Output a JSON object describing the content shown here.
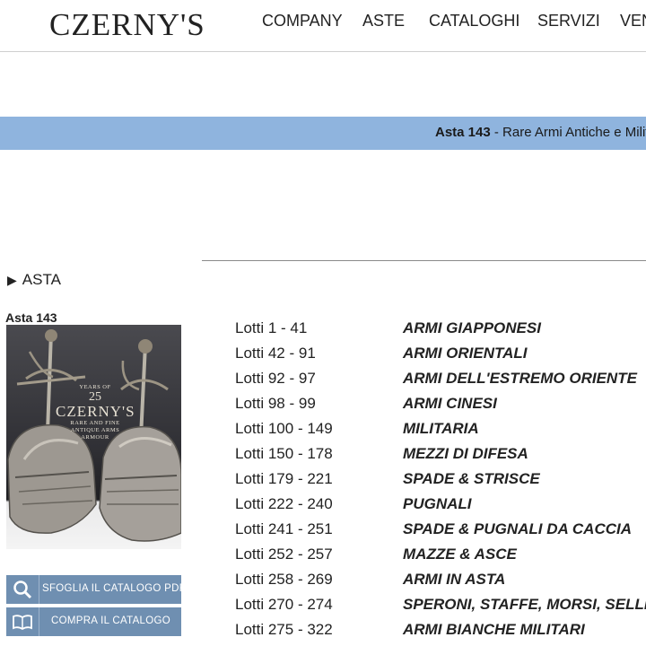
{
  "header": {
    "logo": "CZERNY'S",
    "nav": [
      "COMPANY",
      "ASTE",
      "CATALOGHI",
      "SERVIZI",
      "VEN"
    ]
  },
  "band": {
    "auction_label": "Asta 143",
    "auction_title": " - Rare Armi Antiche e Milita"
  },
  "sidebar": {
    "section_label": "ASTA",
    "auction_number": "Asta 143",
    "cover": {
      "years": "25",
      "years_label": "YEARS OF",
      "brand": "CZERNY'S",
      "line1": "RARE AND FINE",
      "line2": "ANTIQUE ARMS",
      "line3": "ARMOUR"
    },
    "buttons": {
      "browse_pdf": "SFOGLIA IL CATALOGO PDF",
      "buy_catalog": "COMPRA IL CATALOGO"
    }
  },
  "lots": [
    {
      "range": "Lotti 1 - 41",
      "category": "ARMI GIAPPONESI"
    },
    {
      "range": "Lotti 42 - 91",
      "category": "ARMI ORIENTALI"
    },
    {
      "range": "Lotti 92 - 97",
      "category": "ARMI DELL'ESTREMO ORIENTE"
    },
    {
      "range": "Lotti 98 - 99",
      "category": "ARMI CINESI"
    },
    {
      "range": "Lotti 100 - 149",
      "category": "MILITARIA"
    },
    {
      "range": "Lotti 150 - 178",
      "category": "MEZZI DI DIFESA"
    },
    {
      "range": "Lotti 179 - 221",
      "category": "SPADE & STRISCE"
    },
    {
      "range": "Lotti 222 - 240",
      "category": "PUGNALI"
    },
    {
      "range": "Lotti 241 - 251",
      "category": "SPADE & PUGNALI DA CACCIA"
    },
    {
      "range": "Lotti 252 - 257",
      "category": "MAZZE & ASCE"
    },
    {
      "range": "Lotti 258 - 269",
      "category": "ARMI IN ASTA"
    },
    {
      "range": "Lotti 270 - 274",
      "category": "SPERONI, STAFFE, MORSI, SELLE"
    },
    {
      "range": "Lotti 275 - 322",
      "category": "ARMI BIANCHE MILITARI"
    }
  ],
  "icons": {
    "browse_pdf": "search-icon",
    "buy_catalog": "book-icon",
    "section": "triangle-right-icon"
  },
  "colors": {
    "band": "#8fb4de",
    "button": "#6f8fb1"
  }
}
